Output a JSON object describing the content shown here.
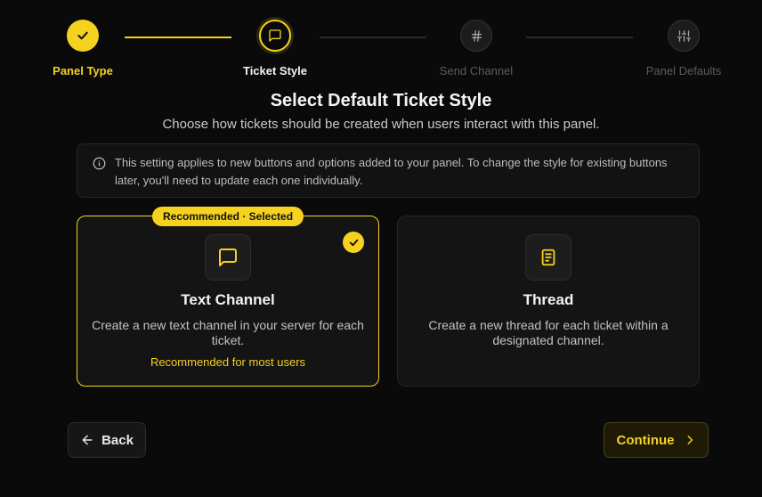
{
  "steps": [
    {
      "label": "Panel Type",
      "state": "done",
      "icon": "check-icon"
    },
    {
      "label": "Ticket Style",
      "state": "active",
      "icon": "message-square-icon"
    },
    {
      "label": "Send Channel",
      "state": "todo",
      "icon": "hash-icon"
    },
    {
      "label": "Panel Defaults",
      "state": "todo",
      "icon": "sliders-icon"
    }
  ],
  "header": {
    "title": "Select Default Ticket Style",
    "subtitle": "Choose how tickets should be created when users interact with this panel."
  },
  "info": {
    "icon": "info-icon",
    "text": "This setting applies to new buttons and options added to your panel. To change the style for existing buttons later, you'll need to update each one individually."
  },
  "options": [
    {
      "badge": "Recommended · Selected",
      "icon": "message-square-icon",
      "title": "Text Channel",
      "description": "Create a new text channel in your server for each ticket.",
      "note": "Recommended for most users",
      "selected": true
    },
    {
      "icon": "document-icon",
      "title": "Thread",
      "description": "Create a new thread for each ticket within a designated channel.",
      "selected": false
    }
  ],
  "actions": {
    "back_label": "Back",
    "continue_label": "Continue"
  },
  "colors": {
    "accent": "#f5d21f",
    "background": "#0a0a0a",
    "card": "#141414"
  }
}
